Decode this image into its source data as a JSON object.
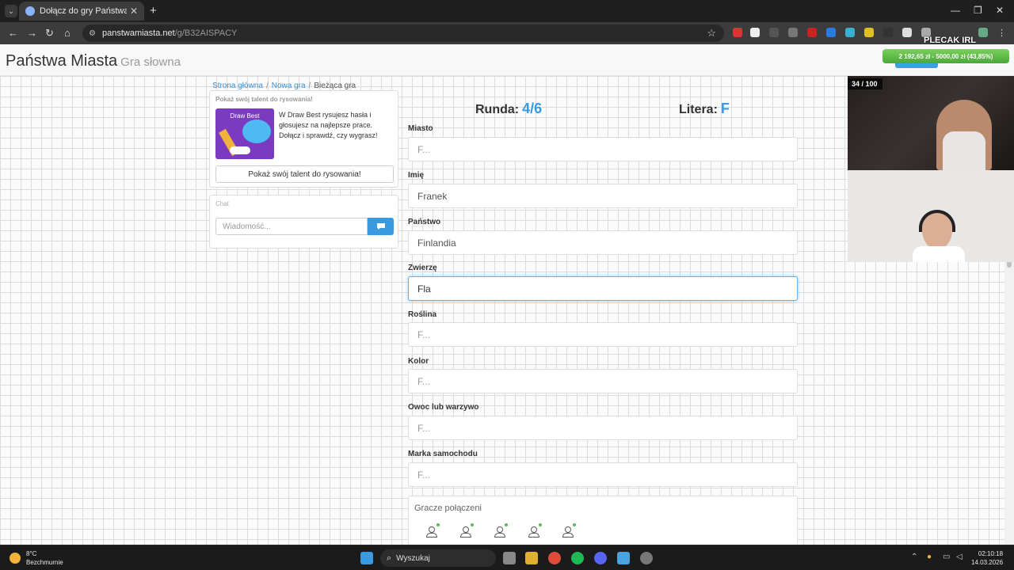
{
  "browser": {
    "tab_title": "Dołącz do gry Państwa Miasta",
    "url_host": "panstwamiasta.net",
    "url_path": "/g/B32AISPACY"
  },
  "overlay": {
    "channel_label": "PLECAK IRL",
    "donation_goal": "2 192,65 zł - 5000,00 zł (43,85%)",
    "viewer_counter": "34 / 100"
  },
  "site": {
    "brand": "Państwa Miasta",
    "brand_sub": "Gra słowna"
  },
  "breadcrumb": {
    "home": "Strona główna",
    "new_game": "Nowa gra",
    "current": "Bieżąca gra"
  },
  "promo": {
    "title": "Pokaż swój talent do rysowania!",
    "image_label": "Draw Best",
    "text": "W Draw Best rysujesz hasła i głosujesz na najlepsze prace. Dołącz i sprawdź, czy wygrasz!",
    "button": "Pokaż swój talent do rysowania!"
  },
  "chat": {
    "title": "Chat",
    "placeholder": "Wiadomość..."
  },
  "game": {
    "round_label": "Runda:",
    "round_value": "4/6",
    "letter_label": "Litera:",
    "letter_value": "F",
    "fields": [
      {
        "label": "Miasto",
        "value": "",
        "placeholder": "F..."
      },
      {
        "label": "Imię",
        "value": "Franek",
        "placeholder": "F..."
      },
      {
        "label": "Państwo",
        "value": "Finlandia",
        "placeholder": "F..."
      },
      {
        "label": "Zwierzę",
        "value": "Fla",
        "placeholder": "F..."
      },
      {
        "label": "Roślina",
        "value": "",
        "placeholder": "F..."
      },
      {
        "label": "Kolor",
        "value": "",
        "placeholder": "F..."
      },
      {
        "label": "Owoc lub warzywo",
        "value": "",
        "placeholder": "F..."
      },
      {
        "label": "Marka samochodu",
        "value": "",
        "placeholder": "F..."
      }
    ],
    "players_title": "Gracze połączeni",
    "player_count": 5
  },
  "taskbar": {
    "temperature": "8°C",
    "weather": "Bezchmurnie",
    "search": "Wyszukaj",
    "time": "02:10:18",
    "date": "14.03.2026"
  }
}
